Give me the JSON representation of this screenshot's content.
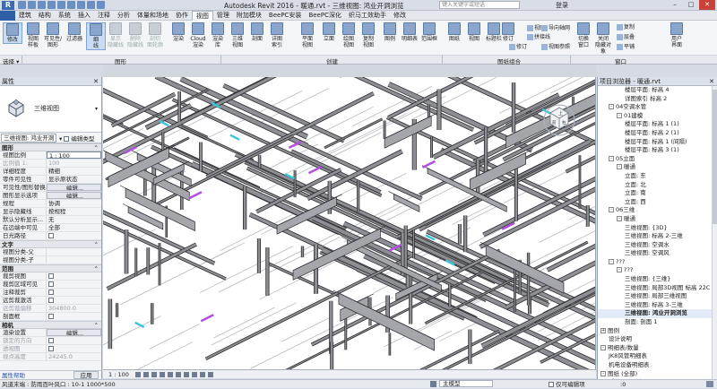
{
  "title_bar": {
    "app_title": "Autodesk Revit 2016 -    暖通.rvt - 三维视图: 鸿业开洞浏览",
    "search_placeholder": "键入关键字或短语",
    "login_label": "登录"
  },
  "menu": {
    "items": [
      "建筑",
      "结构",
      "系统",
      "插入",
      "注释",
      "分析",
      "体量和场地",
      "协作",
      "视图",
      "管理",
      "附加模块",
      "BeePC安装",
      "BeePC深化",
      "织马工效助手",
      "修改"
    ],
    "active": "视图"
  },
  "ribbon": {
    "buttons": [
      {
        "id": "modify",
        "label": "修改"
      },
      {
        "id": "view-template",
        "label": "视图\n样板"
      },
      {
        "id": "visibility",
        "label": "可见性/\n图形"
      },
      {
        "id": "filters",
        "label": "过滤器"
      },
      {
        "id": "thin-lines",
        "label": "细\n线"
      },
      {
        "id": "show-hidden",
        "label": "显示\n隐藏线"
      },
      {
        "id": "remove-hidden",
        "label": "删除\n隐藏线"
      },
      {
        "id": "cut-profile",
        "label": "剖切\n面轮廓"
      },
      {
        "id": "render",
        "label": "渲染"
      },
      {
        "id": "cloud-render",
        "label": "Cloud\n渲染"
      },
      {
        "id": "render-gallery",
        "label": "渲染\n库"
      },
      {
        "id": "3d-view",
        "label": "三维\n视图"
      },
      {
        "id": "section",
        "label": "剖面"
      },
      {
        "id": "callout",
        "label": "详图\n索引"
      },
      {
        "id": "plan-views",
        "label": "平面\n视图"
      },
      {
        "id": "elevation",
        "label": "立面"
      },
      {
        "id": "drafting-view",
        "label": "绘图\n视图"
      },
      {
        "id": "duplicate-view",
        "label": "复制\n视图"
      },
      {
        "id": "legends",
        "label": "图例"
      },
      {
        "id": "schedules",
        "label": "明细表"
      },
      {
        "id": "scope-box",
        "label": "范围框"
      },
      {
        "id": "sheet",
        "label": "图纸"
      },
      {
        "id": "view-placement",
        "label": "视图"
      },
      {
        "id": "title-block",
        "label": "标题栏"
      },
      {
        "id": "matchline",
        "label": "拼接线"
      },
      {
        "id": "revisions",
        "label": "修订"
      },
      {
        "id": "guide-grid",
        "label": "导向轴网"
      },
      {
        "id": "view-ref",
        "label": "视图 参照"
      },
      {
        "id": "switch-windows",
        "label": "切换\n窗口"
      },
      {
        "id": "close-hidden",
        "label": "关闭\n隐藏对象"
      },
      {
        "id": "replicate",
        "label": "复制"
      },
      {
        "id": "cascade",
        "label": "层叠"
      },
      {
        "id": "tile",
        "label": "平铺"
      },
      {
        "id": "user-interface",
        "label": "用户\n界面"
      }
    ],
    "small_items": [
      "视图",
      "拼接线",
      "视图参照",
      "导向轴网",
      "修订"
    ],
    "panel_labels": {
      "select": "选择 ▾",
      "graphics": "图形",
      "create": "创建",
      "sheet_composition": "图纸组合",
      "windows": "窗口"
    }
  },
  "properties": {
    "title": "属性",
    "type_name": "三维视图",
    "selector_value": "三维视图: 鸿业开洞",
    "edit_type_label": "编辑类型",
    "groups": [
      {
        "name": "图形",
        "rows": [
          {
            "label": "视图比例",
            "value": "1 : 100",
            "style": "box"
          },
          {
            "label": "比例值 1:",
            "value": "100",
            "dim": true
          },
          {
            "label": "详细程度",
            "value": "精细"
          },
          {
            "label": "零件可见性",
            "value": "显示原状态"
          },
          {
            "label": "可见性/图形替换",
            "value": "编辑...",
            "style": "edit"
          },
          {
            "label": "图形显示选项",
            "value": "编辑...",
            "style": "edit"
          },
          {
            "label": "规程",
            "value": "协调"
          },
          {
            "label": "显示隐藏线",
            "value": "按规程"
          },
          {
            "label": "默认分析显示...",
            "value": "无"
          },
          {
            "label": "在远端中可见",
            "value": "全部"
          },
          {
            "label": "日光路径",
            "value": "",
            "check": true
          }
        ]
      },
      {
        "name": "文字",
        "rows": [
          {
            "label": "视图分类-父",
            "value": ""
          },
          {
            "label": "视图分类-子",
            "value": ""
          }
        ]
      },
      {
        "name": "范围",
        "rows": [
          {
            "label": "裁剪视图",
            "value": "",
            "check": true
          },
          {
            "label": "裁剪区域可见",
            "value": "",
            "check": true
          },
          {
            "label": "注释裁剪",
            "value": "",
            "check": true
          },
          {
            "label": "远剪裁激活",
            "value": "",
            "check": true
          },
          {
            "label": "远剪裁偏移",
            "value": "304800.0",
            "dim": true
          },
          {
            "label": "剖面框",
            "value": "",
            "check": true
          }
        ]
      },
      {
        "name": "相机",
        "rows": [
          {
            "label": "渲染设置",
            "value": "编辑...",
            "style": "edit"
          },
          {
            "label": "锁定的方向",
            "value": "",
            "check": true,
            "dim": true
          },
          {
            "label": "透视图",
            "value": "",
            "check": true,
            "dim": true
          },
          {
            "label": "视点高度",
            "value": "24245.0",
            "dim": true
          }
        ]
      }
    ],
    "help_link": "属性帮助",
    "apply_label": "应用"
  },
  "viewport": {
    "scale_label": "1 : 100"
  },
  "browser": {
    "title": "项目浏览器 - 暖通.rvt",
    "nodes": [
      {
        "text": "楼层平面: 标高 4",
        "indent": 3
      },
      {
        "text": "详图索引 标高 2",
        "indent": 3
      },
      {
        "text": "04空调水管",
        "indent": 1,
        "toggle": "-"
      },
      {
        "text": "01建模",
        "indent": 2,
        "toggle": "-"
      },
      {
        "text": "楼层平面: 标高 1 (1)",
        "indent": 3
      },
      {
        "text": "楼层平面: 标高 2 (1)",
        "indent": 3
      },
      {
        "text": "楼层平面: 标高 1 (间隔)",
        "indent": 3
      },
      {
        "text": "楼层平面: 标高 3 (1)",
        "indent": 3
      },
      {
        "text": "05立面",
        "indent": 1,
        "toggle": "-"
      },
      {
        "text": "暖通",
        "indent": 2,
        "toggle": "-"
      },
      {
        "text": "立面: 东",
        "indent": 3
      },
      {
        "text": "立面: 北",
        "indent": 3
      },
      {
        "text": "立面: 南",
        "indent": 3
      },
      {
        "text": "立面: 西",
        "indent": 3
      },
      {
        "text": "06三维",
        "indent": 1,
        "toggle": "-"
      },
      {
        "text": "暖通",
        "indent": 2,
        "toggle": "-"
      },
      {
        "text": "三维视图: {3D}",
        "indent": 3
      },
      {
        "text": "三维视图: 标高 2-三维",
        "indent": 3
      },
      {
        "text": "三维视图: 空调水",
        "indent": 3
      },
      {
        "text": "三维视图: 空调风",
        "indent": 3
      },
      {
        "text": "???",
        "indent": 1,
        "toggle": "-"
      },
      {
        "text": "???",
        "indent": 2,
        "toggle": "-"
      },
      {
        "text": "三维视图: {三维}",
        "indent": 3
      },
      {
        "text": "三维视图: 局部3D视图 标高 22C",
        "indent": 3
      },
      {
        "text": "三维视图: 局部三维视图",
        "indent": 3
      },
      {
        "text": "三维视图: 标高 3-三维",
        "indent": 3
      },
      {
        "text": "三维视图: 鸿业开洞浏览",
        "indent": 3,
        "current": true
      },
      {
        "text": "剖面: 剖面 1",
        "indent": 3
      },
      {
        "text": "图例",
        "indent": 0,
        "toggle": "+"
      },
      {
        "text": "设计说明",
        "indent": 1
      },
      {
        "text": "明细表/数量",
        "indent": 0,
        "toggle": "-"
      },
      {
        "text": "JK8风管明细表",
        "indent": 1
      },
      {
        "text": "机电设备明细表",
        "indent": 1
      },
      {
        "text": "图纸 (全部)",
        "indent": 0,
        "toggle": "-"
      },
      {
        "text": "暖体-04 - 封面",
        "indent": 1
      }
    ]
  },
  "status": {
    "text": "风道末端 : 防雨百叶风口 : 10-1 1000*500",
    "workset_value": "主模型",
    "exclude_label": "仅可编辑项",
    "zero": ":0"
  },
  "colors": {
    "accent": "#2f5fa6",
    "pipe_fill": "#8e8f94",
    "pipe_edge": "#2b2b2e",
    "highlight_magenta": "#b24fe0",
    "highlight_cyan": "#3ec6d8"
  }
}
